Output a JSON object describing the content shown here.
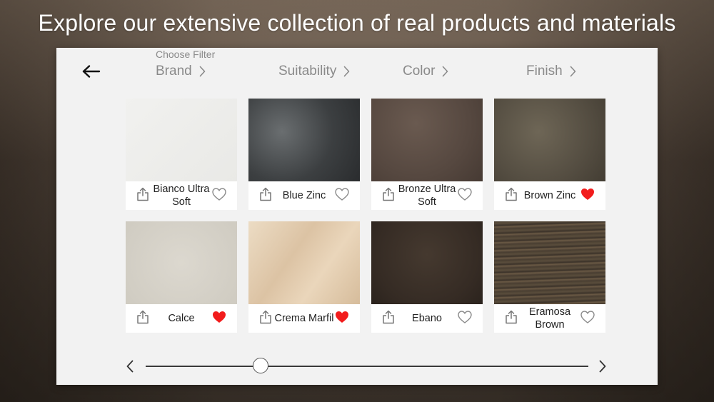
{
  "headline": "Explore our extensive collection of real products and materials",
  "back_icon": "arrow-left-icon",
  "filter_caption": "Choose Filter",
  "filters": [
    {
      "label": "Brand",
      "icon": "chevron-right-icon"
    },
    {
      "label": "Suitability",
      "icon": "chevron-right-icon"
    },
    {
      "label": "Color",
      "icon": "chevron-right-icon"
    },
    {
      "label": "Finish",
      "icon": "chevron-right-icon"
    }
  ],
  "products": [
    {
      "name": "Bianco Ultra Soft",
      "favorite": false,
      "swatch_color": "#efefed"
    },
    {
      "name": "Blue Zinc",
      "favorite": false,
      "swatch_color": "#4a4d4f"
    },
    {
      "name": "Bronze Ultra Soft",
      "favorite": false,
      "swatch_color": "#5e5048"
    },
    {
      "name": "Brown Zinc",
      "favorite": true,
      "swatch_color": "#5b5447"
    },
    {
      "name": "Calce",
      "favorite": true,
      "swatch_color": "#d6d2c8"
    },
    {
      "name": "Crema Marfil",
      "favorite": true,
      "swatch_color": "#e2cdb0"
    },
    {
      "name": "Ebano",
      "favorite": false,
      "swatch_color": "#3b3129"
    },
    {
      "name": "Eramosa Brown",
      "favorite": false,
      "swatch_color": "#4d4234"
    }
  ],
  "colors": {
    "favorite_active": "#f21c1c",
    "icon_gray": "#8a8a8a",
    "text_dark": "#222222"
  },
  "pager": {
    "prev_icon": "chevron-left-icon",
    "next_icon": "chevron-right-icon",
    "position": 0.26
  }
}
